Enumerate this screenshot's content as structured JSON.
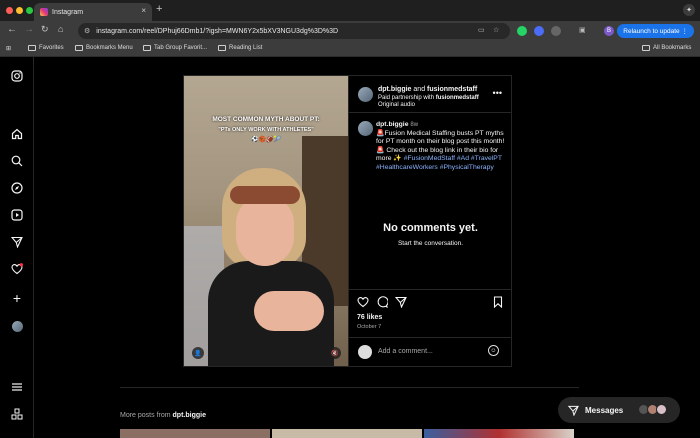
{
  "browser": {
    "tab_title": "Instagram",
    "tab_close": "×",
    "new_tab": "+",
    "url": "instagram.com/reel/DPhuj66Dmb1/?igsh=MWN6Y2x5bXV3NGU3dg%3D%3D",
    "relaunch_label": "Relaunch to update",
    "profile_initial": "B",
    "bookmarks": [
      "Favorites",
      "Bookmarks Menu",
      "Tab Group Favorit...",
      "Reading List"
    ],
    "all_bookmarks": "All Bookmarks"
  },
  "post": {
    "video": {
      "title": "MOST COMMON MYTH ABOUT PT:",
      "subtitle": "\"PTs ONLY WORK WITH ATHLETES\"",
      "emojis": "⚽🏀🏈🎾"
    },
    "header": {
      "username": "dpt.biggie",
      "and": "and",
      "collab": "fusionmedstaff",
      "partnership_prefix": "Paid partnership with",
      "partnership_brand": "fusionmedstaff",
      "audio": "Original audio"
    },
    "caption": {
      "username": "dpt.biggie",
      "age": "8w",
      "text": "🚨Fusion Medical Staffing busts PT myths for PT month on their blog post this month!🚨 Check out the blog link in their bio for more ✨",
      "hashtags": [
        "#FusionMedStaff",
        "#Ad",
        "#TravelPT",
        "#HealthcareWorkers",
        "#PhysicalTherapy"
      ]
    },
    "comments_empty_title": "No comments yet.",
    "comments_empty_sub": "Start the conversation.",
    "likes": "76 likes",
    "date": "October 7",
    "comment_placeholder": "Add a comment..."
  },
  "more_posts": {
    "prefix": "More posts from",
    "username": "dpt.biggie"
  },
  "messages": {
    "label": "Messages"
  }
}
